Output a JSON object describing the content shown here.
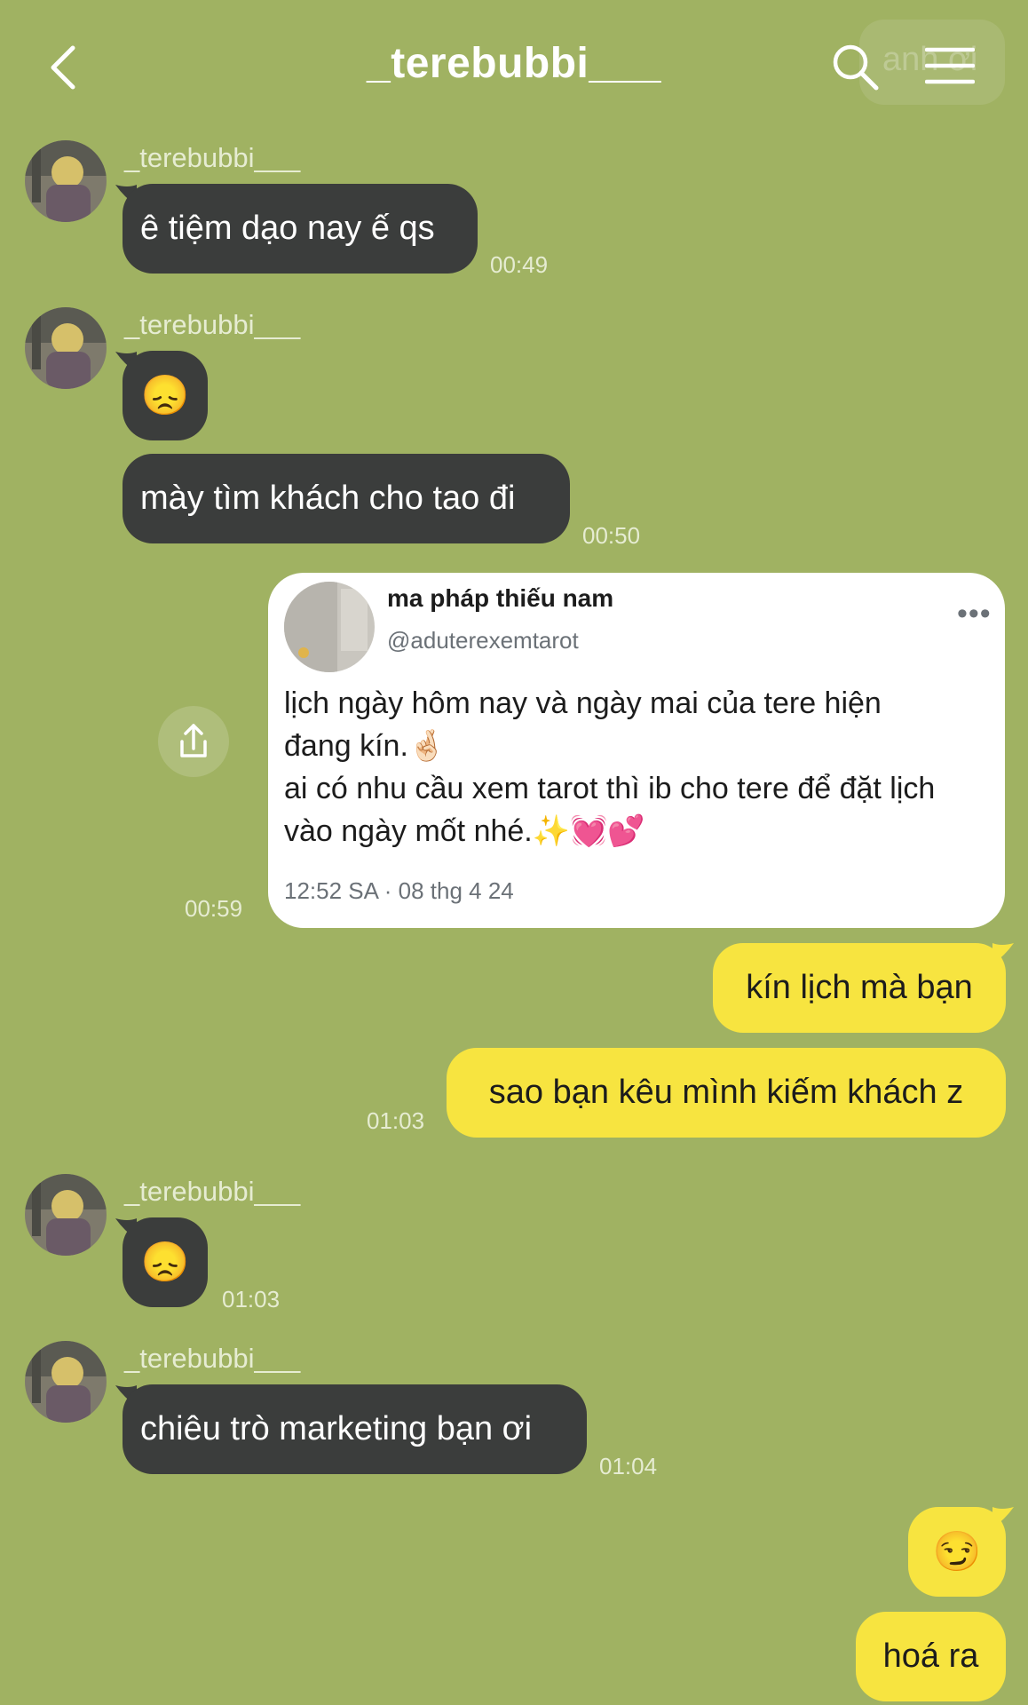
{
  "header": {
    "title": "_terebubbi___",
    "faint_overlay_text": "anh ơi",
    "back_icon": "chevron-left-icon",
    "search_icon": "search-icon",
    "menu_icon": "hamburger-menu-icon"
  },
  "messages": [
    {
      "sender": "_terebubbi___",
      "text": "ê tiệm dạo nay ế qs",
      "time": "00:49"
    },
    {
      "sender": "_terebubbi___",
      "text": "😞",
      "time": ""
    },
    {
      "sender": "",
      "text": "mày tìm khách cho tao đi",
      "time": "00:50"
    },
    {
      "sender": "_terebubbi___",
      "text": "😞",
      "time": "01:03"
    },
    {
      "sender": "_terebubbi___",
      "text": "chiêu trò marketing bạn ơi",
      "time": "01:04"
    }
  ],
  "shared_post": {
    "name": "ma pháp thiếu nam",
    "handle": "@aduterexemtarot",
    "more": "•••",
    "line1": "lịch ngày hôm nay và ngày mai của tere hiện",
    "line2": "đang kín.🤞🏻",
    "line3": "ai có nhu cầu xem tarot thì ib cho tere để đặt lịch",
    "line4": "vào ngày mốt nhé.✨💓💕",
    "posted": "12:52 SA · 08 thg 4 24",
    "time": "00:59"
  },
  "my_messages": [
    {
      "text": "kín lịch mà bạn",
      "time": ""
    },
    {
      "text": "sao bạn kêu mình kiếm khách z",
      "time": "01:03"
    },
    {
      "text": "😏",
      "time": ""
    },
    {
      "text": "hoá ra",
      "time": ""
    }
  ],
  "colors": {
    "background": "#a0b262",
    "incoming_bubble": "#3b3d3c",
    "outgoing_bubble": "#f7e440"
  }
}
